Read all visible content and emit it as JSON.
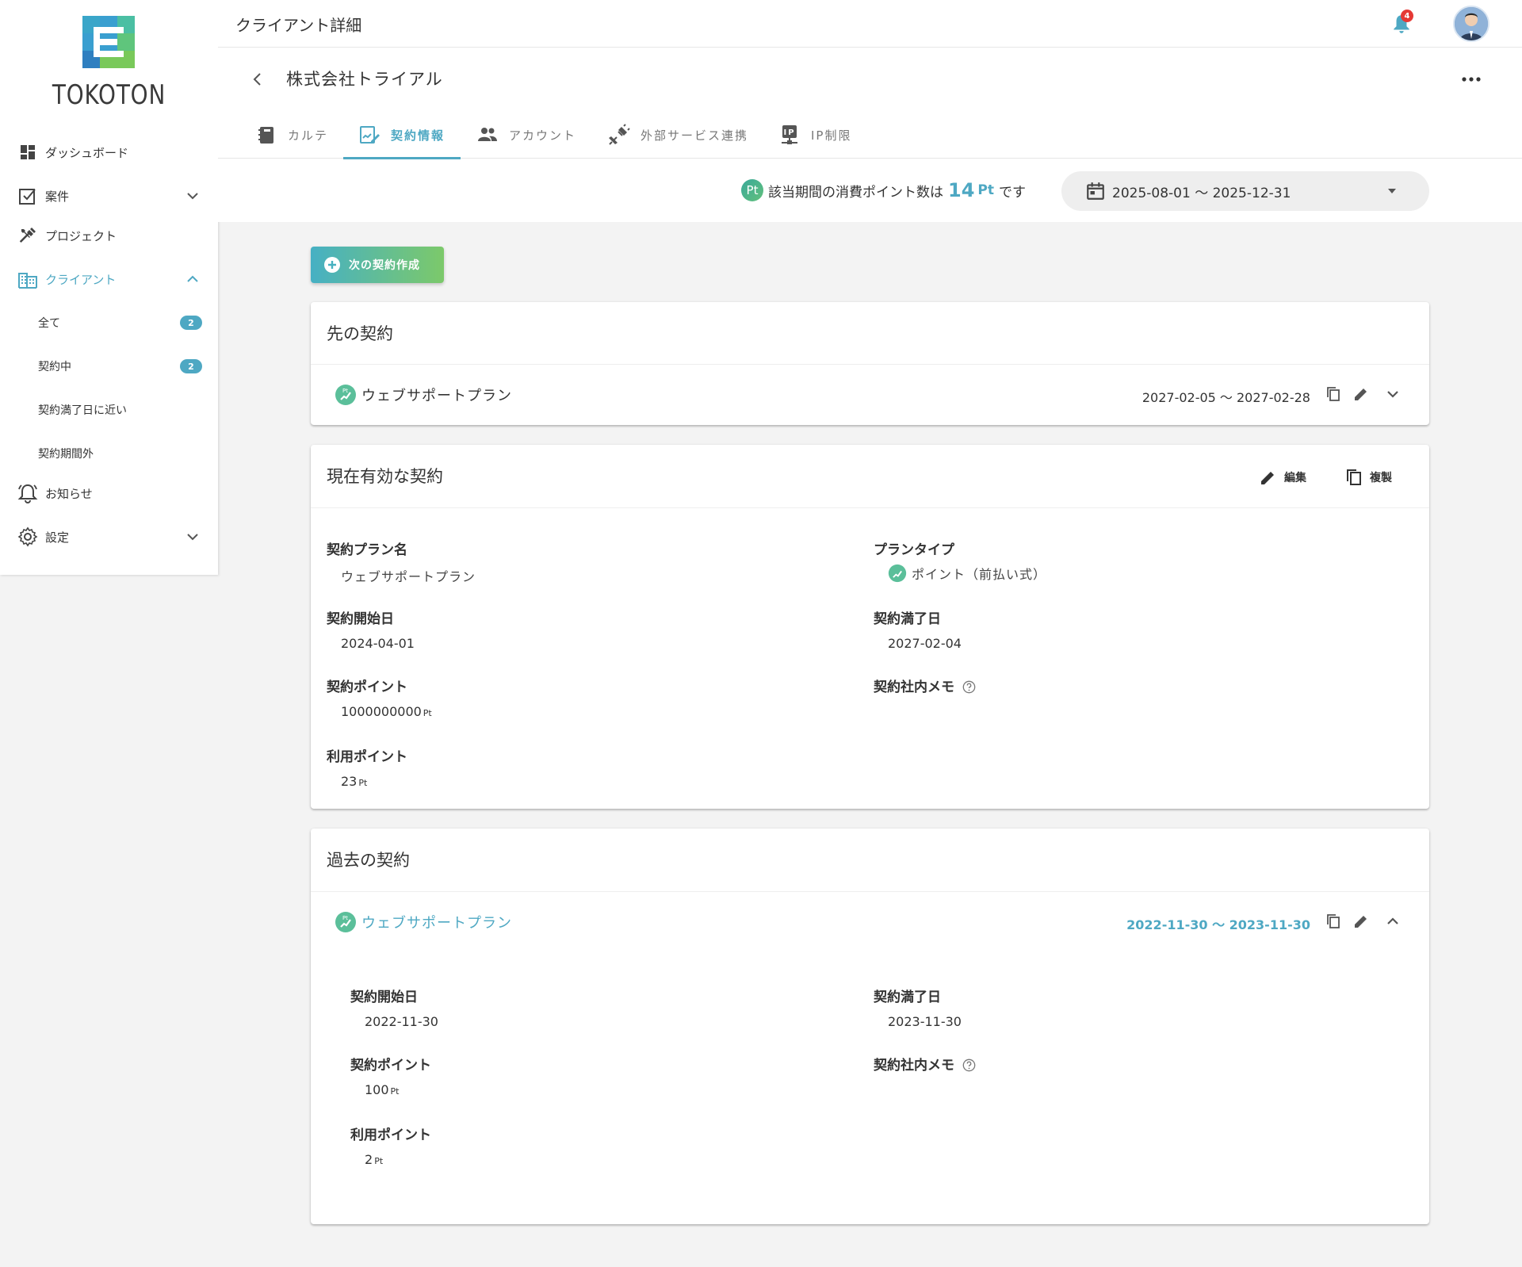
{
  "app": {
    "logo_text": "TOKOTON"
  },
  "sidebar": {
    "items": [
      {
        "label": "ダッシュボード"
      },
      {
        "label": "案件"
      },
      {
        "label": "プロジェクト"
      },
      {
        "label": "クライアント"
      },
      {
        "label": "お知らせ"
      },
      {
        "label": "設定"
      }
    ],
    "client_sub": [
      {
        "label": "全て",
        "count": "2"
      },
      {
        "label": "契約中",
        "count": "2"
      },
      {
        "label": "契約満了日に近い"
      },
      {
        "label": "契約期間外"
      }
    ]
  },
  "header": {
    "title": "クライアント詳細",
    "notification_count": "4",
    "client_name": "株式会社トライアル"
  },
  "tabs": [
    {
      "label": "カルテ"
    },
    {
      "label": "契約情報"
    },
    {
      "label": "アカウント"
    },
    {
      "label": "外部サービス連携"
    },
    {
      "label": "IP制限"
    }
  ],
  "points_summary": {
    "icon_text": "Pt",
    "prefix": "該当期間の消費ポイント数は",
    "value": "14",
    "unit": "Pt",
    "suffix": "です",
    "date_range": "2025-08-01 〜 2025-12-31"
  },
  "new_contract_button": "次の契約作成",
  "future_contracts": {
    "title": "先の契約",
    "row": {
      "plan_name": "ウェブサポートプラン",
      "dates": "2027-02-05 〜 2027-02-28"
    }
  },
  "current_contract": {
    "title": "現在有効な契約",
    "edit_label": "編集",
    "copy_label": "複製",
    "fields": {
      "plan_name_label": "契約プラン名",
      "plan_name_value": "ウェブサポートプラン",
      "plan_type_label": "プランタイプ",
      "plan_type_value": "ポイント（前払い式）",
      "start_label": "契約開始日",
      "start_value": "2024-04-01",
      "end_label": "契約満了日",
      "end_value": "2027-02-04",
      "points_label": "契約ポイント",
      "points_value": "1000000000",
      "memo_label": "契約社内メモ",
      "used_label": "利用ポイント",
      "used_value": "23"
    },
    "unit": "Pt"
  },
  "past_contracts": {
    "title": "過去の契約",
    "row": {
      "plan_name": "ウェブサポートプラン",
      "dates": "2022-11-30 〜 2023-11-30"
    },
    "fields": {
      "start_label": "契約開始日",
      "start_value": "2022-11-30",
      "end_label": "契約満了日",
      "end_value": "2023-11-30",
      "points_label": "契約ポイント",
      "points_value": "100",
      "memo_label": "契約社内メモ",
      "used_label": "利用ポイント",
      "used_value": "2"
    },
    "unit": "Pt"
  },
  "colors": {
    "accent": "#4ea8c3",
    "gradient_start": "#46b0c4",
    "gradient_end": "#7cc96a",
    "badge_red": "#e53935"
  }
}
